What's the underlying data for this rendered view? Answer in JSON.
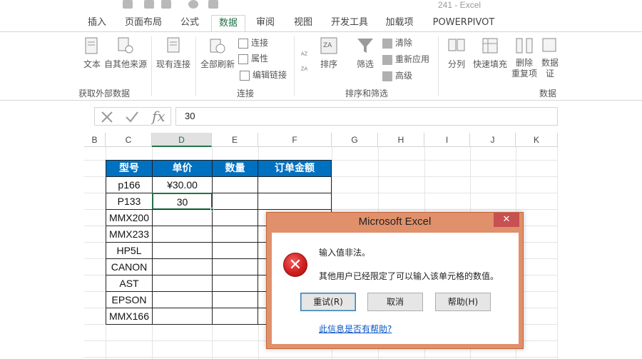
{
  "window": {
    "title": "241 - Excel"
  },
  "tabs": [
    {
      "label": "插入"
    },
    {
      "label": "页面布局"
    },
    {
      "label": "公式"
    },
    {
      "label": "数据"
    },
    {
      "label": "审阅"
    },
    {
      "label": "视图"
    },
    {
      "label": "开发工具"
    },
    {
      "label": "加载项"
    },
    {
      "label": "POWERPIVOT"
    }
  ],
  "ribbon": {
    "external": {
      "text_label": "文本",
      "other_sources": "自其他来源",
      "group_name": "获取外部数据"
    },
    "existing": {
      "label": "现有连接"
    },
    "refresh": {
      "label": "全部刷新"
    },
    "connections": {
      "connections": "连接",
      "properties": "属性",
      "edit_links": "编辑链接",
      "group_name": "连接"
    },
    "sort_filter": {
      "sort": "排序",
      "filter": "筛选",
      "clear": "清除",
      "reapply": "重新应用",
      "advanced": "高级",
      "group_name": "排序和筛选"
    },
    "tools": {
      "split": "分列",
      "flash_fill": "快速填充",
      "remove_dup_1": "删除",
      "remove_dup_2": "重复项",
      "validate_1": "数据",
      "validate_2": "证",
      "group_name": "数据"
    }
  },
  "formula_bar": {
    "value": "30",
    "fx": "fx"
  },
  "column_headers": [
    "B",
    "C",
    "D",
    "E",
    "F",
    "G",
    "H",
    "I",
    "J",
    "K"
  ],
  "table": {
    "headers": [
      "型号",
      "单价",
      "数量",
      "订单金额"
    ],
    "rows": [
      [
        "p166",
        "¥30.00",
        "",
        ""
      ],
      [
        "P133",
        "30",
        "",
        ""
      ],
      [
        "MMX200",
        "",
        "",
        ""
      ],
      [
        "MMX233",
        "",
        "",
        ""
      ],
      [
        "HP5L",
        "",
        "",
        ""
      ],
      [
        "CANON",
        "",
        "",
        ""
      ],
      [
        "AST",
        "",
        "",
        ""
      ],
      [
        "EPSON",
        "",
        "",
        ""
      ],
      [
        "MMX166",
        "",
        "",
        ""
      ]
    ]
  },
  "dialog": {
    "title": "Microsoft Excel",
    "close": "✕",
    "message_1": "输入值非法。",
    "message_2": "其他用户已经限定了可以输入该单元格的数值。",
    "retry": "重试(R)",
    "cancel": "取消",
    "help": "帮助(H)",
    "link": "此信息是否有帮助?"
  },
  "colors": {
    "accent": "#217346",
    "header_fill": "#0070c0",
    "dialog_frame": "#e0906a",
    "error_red": "#d21f1f"
  }
}
